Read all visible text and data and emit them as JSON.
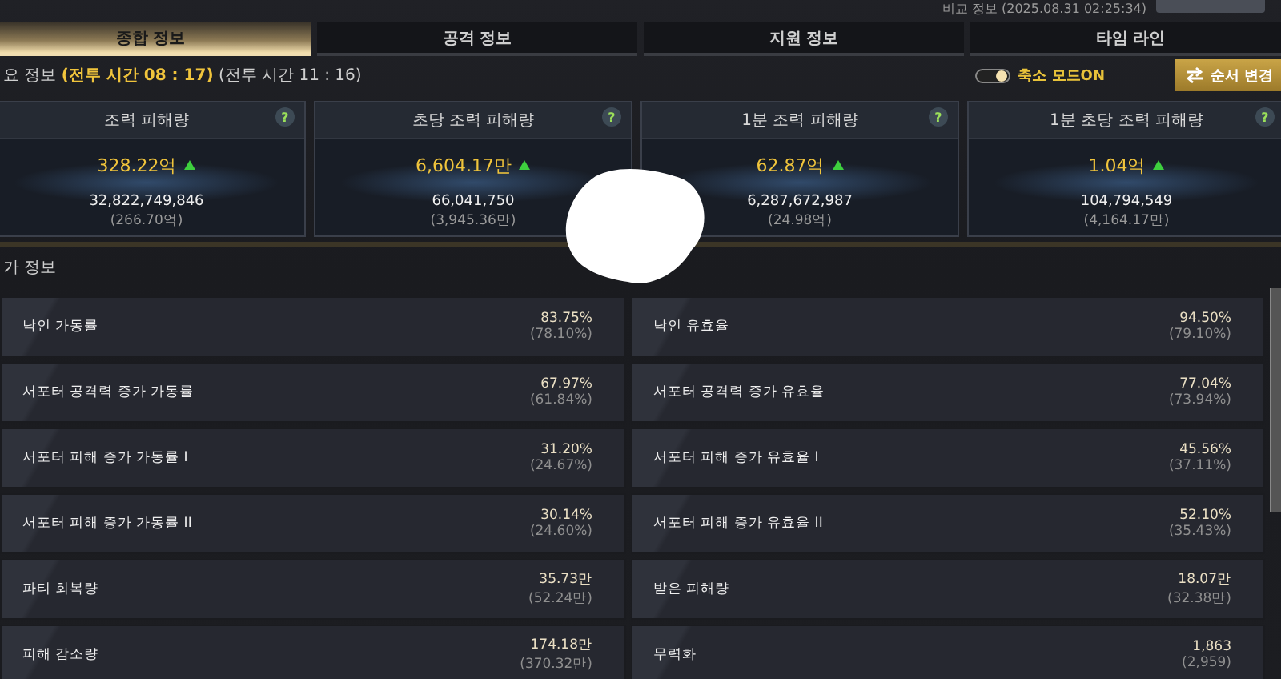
{
  "header": {
    "compare_info": "비교 정보 (2025.08.31 02:25:34)"
  },
  "tabs": [
    {
      "label": "종합 정보",
      "selected": true
    },
    {
      "label": "공격 정보",
      "selected": false
    },
    {
      "label": "지원 정보",
      "selected": false
    },
    {
      "label": "타임 라인",
      "selected": false
    }
  ],
  "summary": {
    "title": "요 정보",
    "battle_time": "(전투 시간 08 : 17)",
    "compare_time": "(전투 시간 11 : 16)"
  },
  "toggle": {
    "label": "축소 모드ON",
    "on": true
  },
  "order_button": "순서 변경",
  "cards": [
    {
      "title": "조력 피해량",
      "help": "?",
      "value": "328.22억",
      "rising": true,
      "total": "32,822,749,846",
      "compare": "(266.70억)"
    },
    {
      "title": "초당 조력 피해량",
      "help": "?",
      "value": "6,604.17만",
      "rising": true,
      "total": "66,041,750",
      "compare": "(3,945.36만)"
    },
    {
      "title": "1분 조력 피해량",
      "help": "?",
      "value": "62.87억",
      "rising": true,
      "total": "6,287,672,987",
      "compare": "(24.98억)"
    },
    {
      "title": "1분 초당 조력 피해량",
      "help": "?",
      "value": "1.04억",
      "rising": true,
      "total": "104,794,549",
      "compare": "(4,164.17만)"
    }
  ],
  "section_title": "가 정보",
  "stats": [
    {
      "label": "낙인 가동률",
      "value": "83.75%",
      "compare": "(78.10%)"
    },
    {
      "label": "낙인 유효율",
      "value": "94.50%",
      "compare": "(79.10%)"
    },
    {
      "label": "서포터 공격력 증가 가동률",
      "value": "67.97%",
      "compare": "(61.84%)"
    },
    {
      "label": "서포터 공격력 증가 유효율",
      "value": "77.04%",
      "compare": "(73.94%)"
    },
    {
      "label": "서포터 피해 증가 가동률 I",
      "value": "31.20%",
      "compare": "(24.67%)"
    },
    {
      "label": "서포터 피해 증가 유효율 I",
      "value": "45.56%",
      "compare": "(37.11%)"
    },
    {
      "label": "서포터 피해 증가 가동률 II",
      "value": "30.14%",
      "compare": "(24.60%)"
    },
    {
      "label": "서포터 피해 증가 유효율 II",
      "value": "52.10%",
      "compare": "(35.43%)"
    },
    {
      "label": "파티 회복량",
      "value": "35.73만",
      "compare": "(52.24만)"
    },
    {
      "label": "받은 피해량",
      "value": "18.07만",
      "compare": "(32.38만)"
    },
    {
      "label": "피해 감소량",
      "value": "174.18만",
      "compare": "(370.32만)"
    },
    {
      "label": "무력화",
      "value": "1,863",
      "compare": "(2,959)"
    }
  ]
}
